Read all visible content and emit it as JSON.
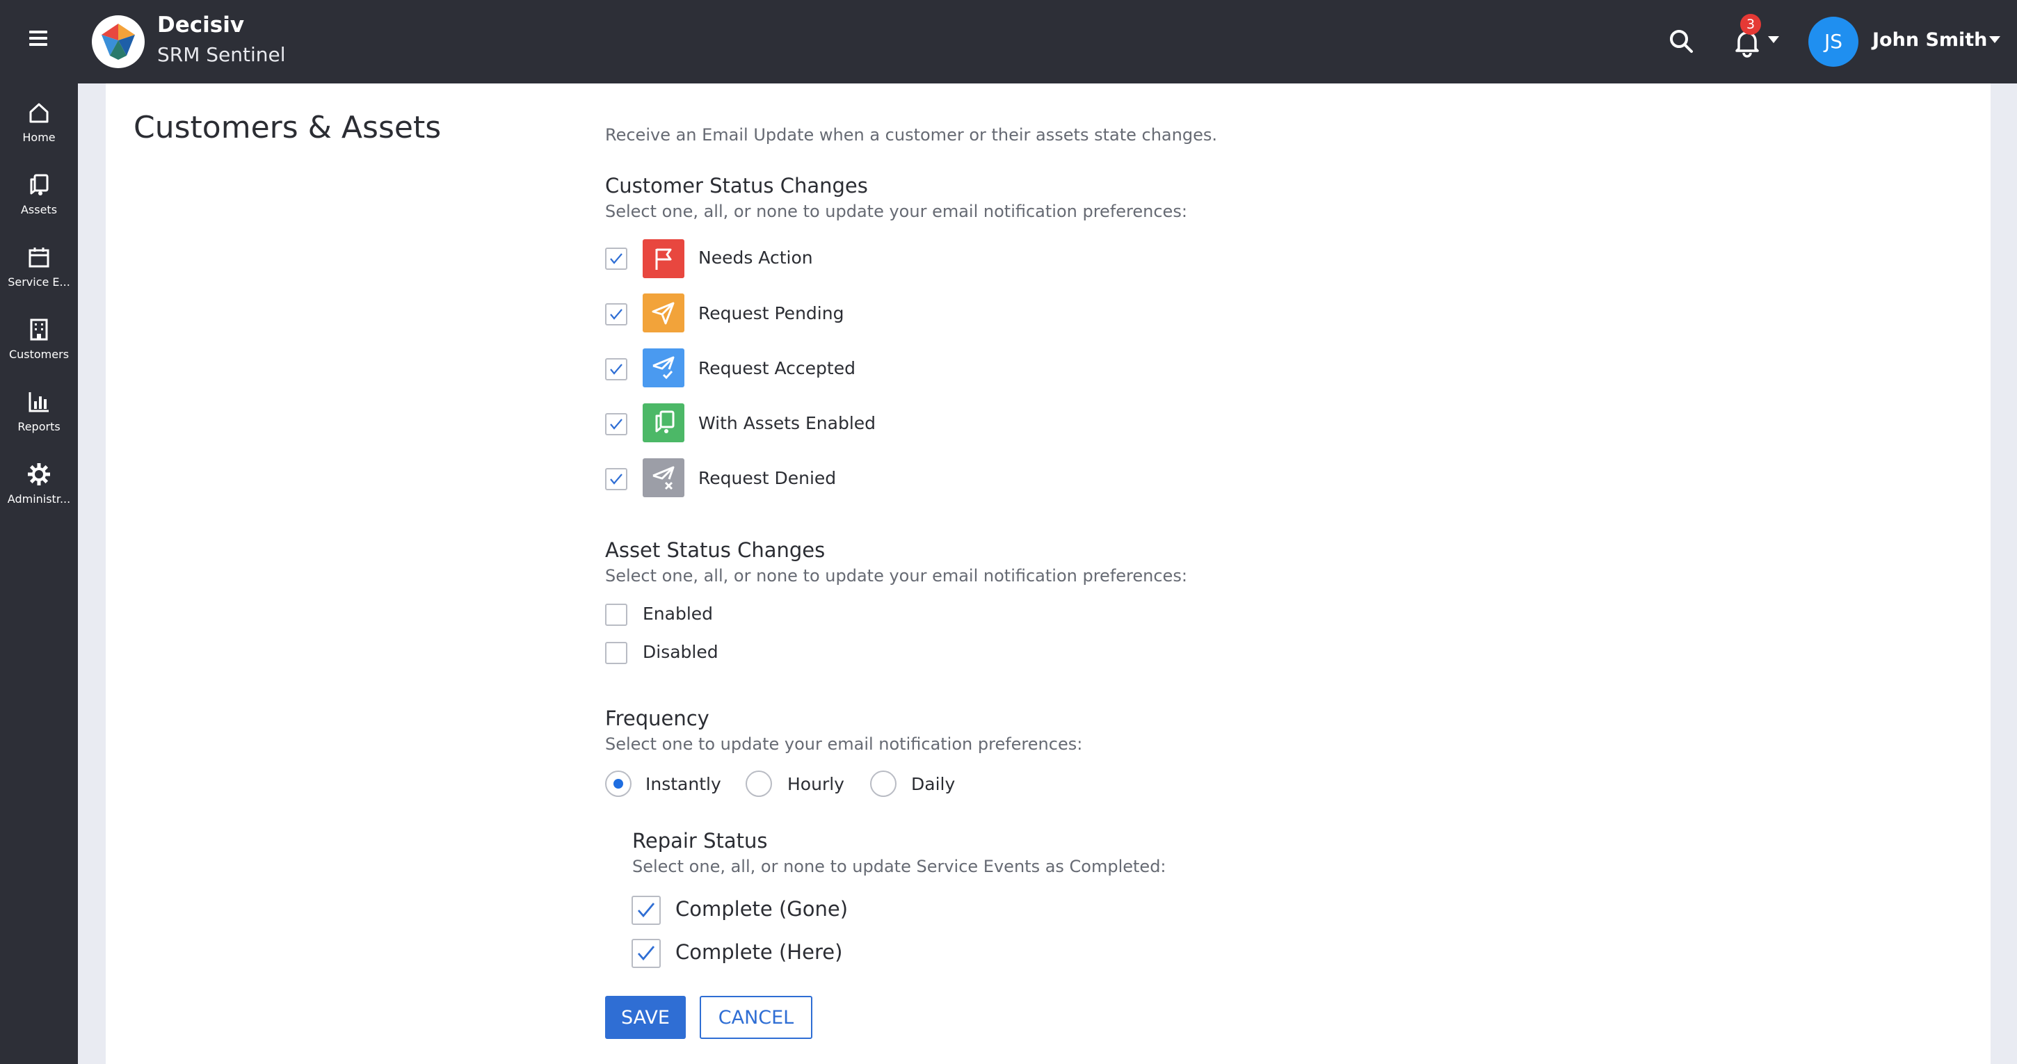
{
  "header": {
    "brand_name": "Decisiv",
    "brand_subtitle": "SRM Sentinel",
    "notification_count": "3",
    "user_initials": "JS",
    "user_name": "John Smith",
    "icons": [
      "menu-icon",
      "logo",
      "search-icon",
      "bell-icon",
      "caret-down-icon"
    ]
  },
  "sidebar": {
    "items": [
      {
        "label": "Home",
        "icon": "home-icon"
      },
      {
        "label": "Assets",
        "icon": "assets-icon"
      },
      {
        "label": "Service E...",
        "icon": "calendar-icon"
      },
      {
        "label": "Customers",
        "icon": "building-icon"
      },
      {
        "label": "Reports",
        "icon": "bar-chart-icon"
      },
      {
        "label": "Administr...",
        "icon": "gear-icon"
      }
    ]
  },
  "main": {
    "page_title": "Customers & Assets",
    "intro": "Receive an Email Update when a customer or their assets state changes.",
    "customer_status": {
      "title": "Customer Status Changes",
      "subtitle": "Select one, all, or none to update your email notification preferences:",
      "options": [
        {
          "label": "Needs Action",
          "checked": true,
          "icon": "flag-icon",
          "color": "#e8473f"
        },
        {
          "label": "Request Pending",
          "checked": true,
          "icon": "paper-plane-icon",
          "color": "#f2a33a"
        },
        {
          "label": "Request Accepted",
          "checked": true,
          "icon": "paper-plane-check-icon",
          "color": "#4a9af0"
        },
        {
          "label": "With Assets Enabled",
          "checked": true,
          "icon": "assets-icon",
          "color": "#4cb867"
        },
        {
          "label": "Request Denied",
          "checked": true,
          "icon": "paper-plane-x-icon",
          "color": "#9c9ea7"
        }
      ]
    },
    "asset_status": {
      "title": "Asset Status Changes",
      "subtitle": "Select one, all, or none to update your email notification preferences:",
      "options": [
        {
          "label": "Enabled",
          "checked": false
        },
        {
          "label": "Disabled",
          "checked": false
        }
      ]
    },
    "frequency": {
      "title": "Frequency",
      "subtitle": "Select one to update your email notification preferences:",
      "options": [
        {
          "label": "Instantly",
          "selected": true
        },
        {
          "label": "Hourly",
          "selected": false
        },
        {
          "label": "Daily",
          "selected": false
        }
      ]
    },
    "repair_status": {
      "title": "Repair Status",
      "subtitle": "Select one, all, or none to update Service Events as Completed:",
      "options": [
        {
          "label": "Complete (Gone)",
          "checked": true
        },
        {
          "label": "Complete (Here)",
          "checked": true
        }
      ]
    },
    "actions": {
      "save_label": "SAVE",
      "cancel_label": "CANCEL"
    }
  },
  "colors": {
    "chrome": "#2d2f37",
    "accent": "#2f6ed4",
    "badge": "#e53935",
    "avatar": "#1f8ff0"
  }
}
